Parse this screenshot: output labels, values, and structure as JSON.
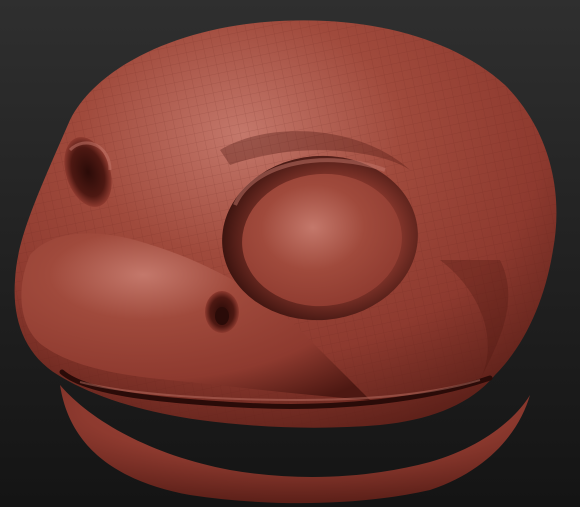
{
  "scene": {
    "subject": "sculpted-turtle-head",
    "background_top": "#2f2f2f",
    "background_bottom": "#141414",
    "material": {
      "base": "#8e3a2f",
      "highlight": "#c4786b",
      "mid": "#a04a3c",
      "shadow": "#4d1812",
      "deep_shadow": "#2a0b08",
      "wire": "#5e1e17"
    }
  }
}
